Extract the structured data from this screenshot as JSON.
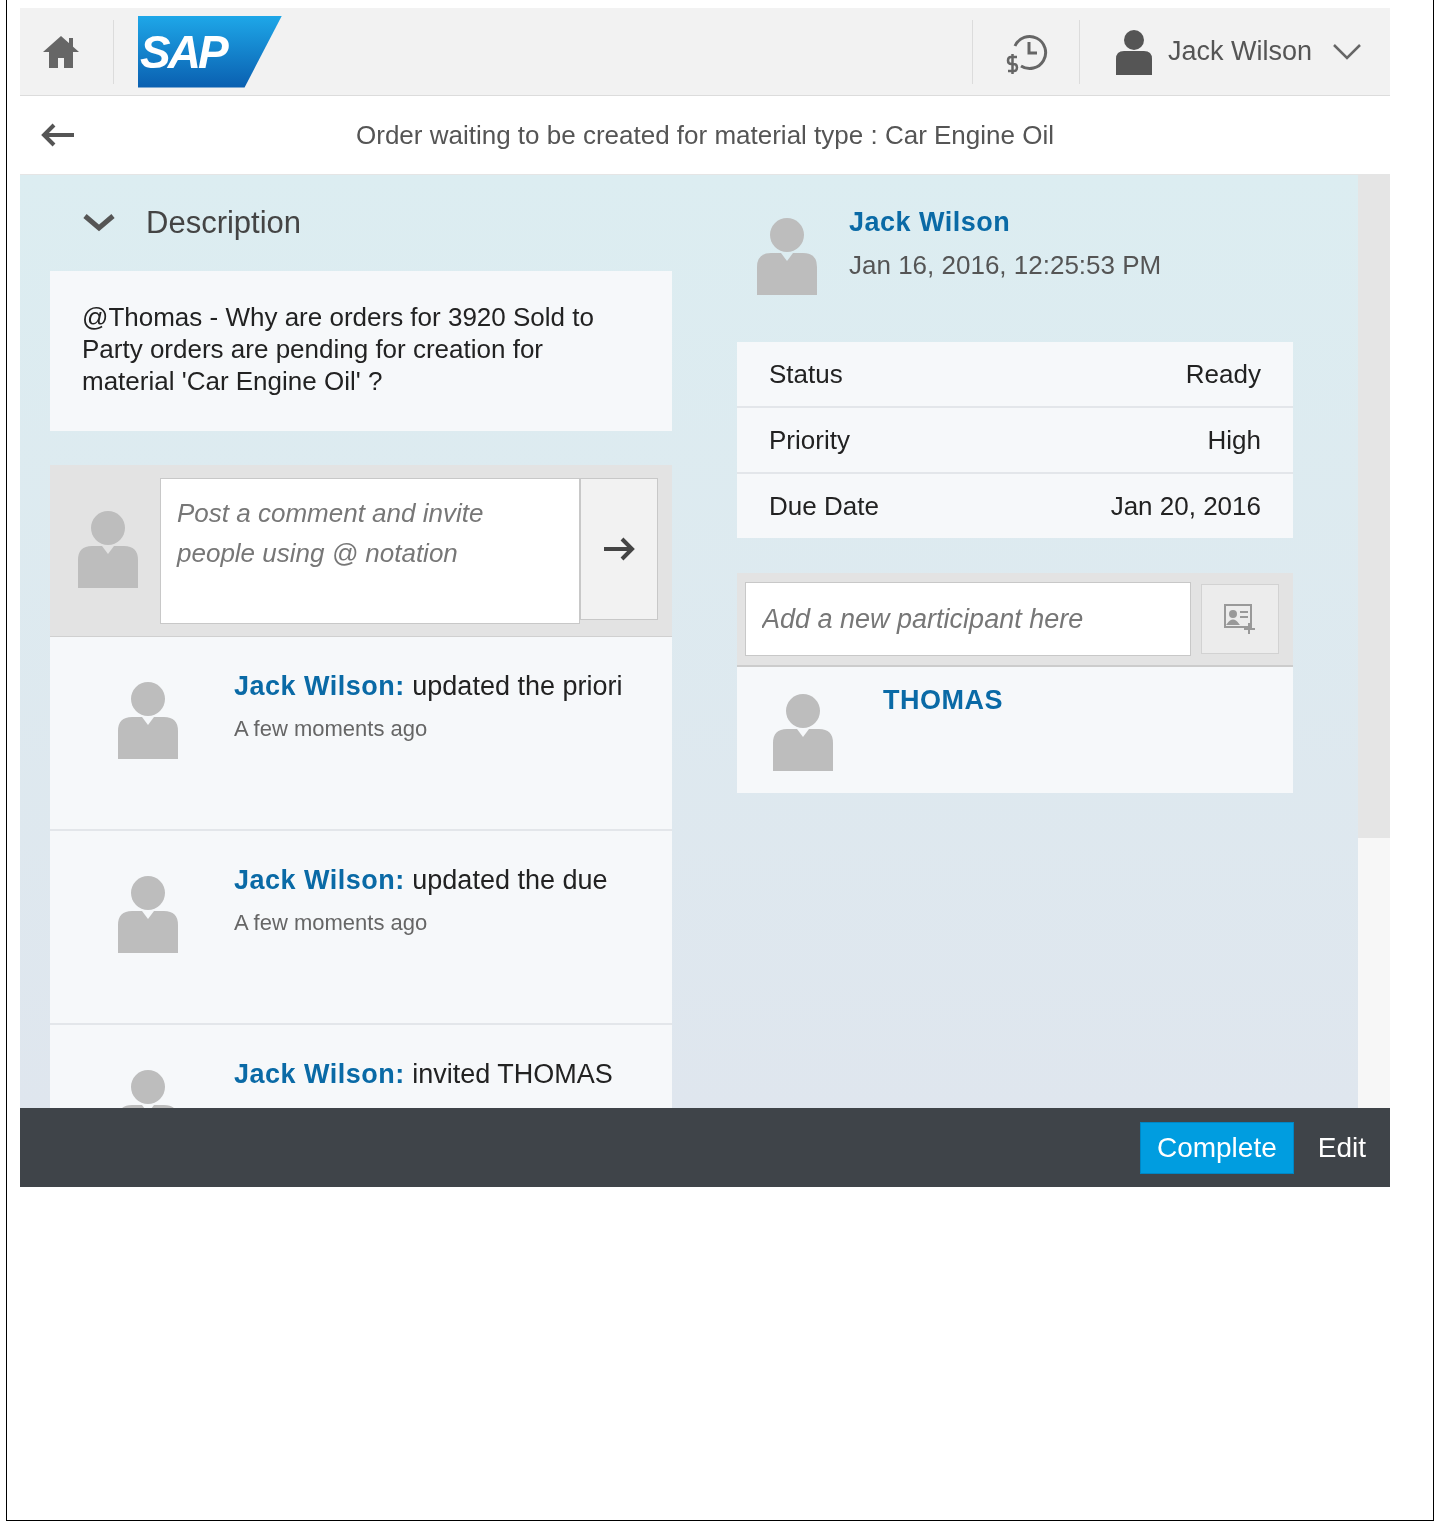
{
  "header": {
    "logo_text": "SAP",
    "user_name": "Jack Wilson"
  },
  "page_title": "Order waiting to be created for material type : Car Engine Oil",
  "description": {
    "heading": "Description",
    "expanded": true,
    "text": "@Thomas - Why are orders for 3920 Sold to Party orders are pending for creation for material 'Car Engine Oil' ?"
  },
  "comment_box": {
    "placeholder": "Post a comment and invite people using @ notation"
  },
  "feed": [
    {
      "author": "Jack Wilson:",
      "action": "updated the priori",
      "time": "A few moments ago"
    },
    {
      "author": "Jack Wilson:",
      "action": "updated the due",
      "time": "A few moments ago"
    },
    {
      "author": "Jack Wilson:",
      "action": "invited THOMAS"
    }
  ],
  "task": {
    "creator": "Jack Wilson",
    "created": "Jan 16, 2016, 12:25:53 PM",
    "properties": [
      {
        "label": "Status",
        "value": "Ready"
      },
      {
        "label": "Priority",
        "value": "High"
      },
      {
        "label": "Due Date",
        "value": "Jan 20, 2016"
      }
    ]
  },
  "participants": {
    "placeholder": "Add a new participant here",
    "items": [
      {
        "name": "THOMAS"
      }
    ]
  },
  "footer": {
    "buttons": [
      {
        "label": "Complete",
        "kind": "primary"
      },
      {
        "label": "Edit",
        "kind": "plain"
      }
    ]
  }
}
